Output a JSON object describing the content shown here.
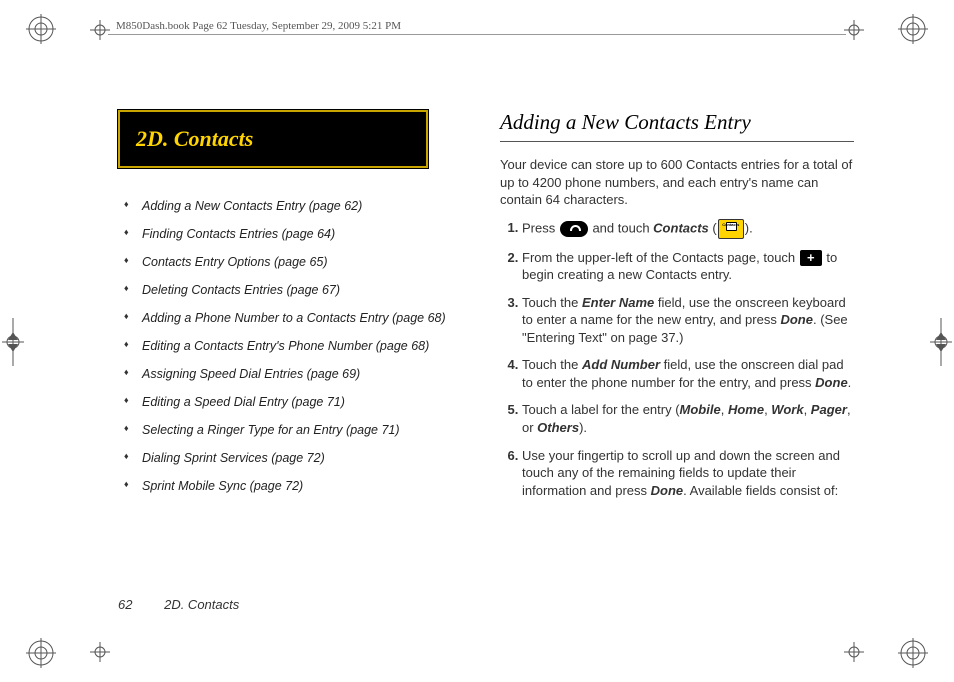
{
  "header": {
    "running": "M850Dash.book  Page 62  Tuesday, September 29, 2009  5:21 PM"
  },
  "section": {
    "title": "2D. Contacts"
  },
  "toc": [
    "Adding a New Contacts Entry (page 62)",
    "Finding Contacts Entries (page 64)",
    "Contacts Entry Options (page 65)",
    "Deleting Contacts Entries (page 67)",
    "Adding a Phone Number to a Contacts Entry (page 68)",
    "Editing a Contacts Entry's Phone Number (page 68)",
    "Assigning Speed Dial Entries (page 69)",
    "Editing a Speed Dial Entry (page 71)",
    "Selecting a Ringer Type for an Entry (page 71)",
    "Dialing Sprint Services (page 72)",
    "Sprint Mobile Sync (page 72)"
  ],
  "right": {
    "heading": "Adding a New Contacts Entry",
    "intro": "Your device can store up to 600 Contacts entries for a total of up to 4200 phone numbers, and each entry's name can contain 64 characters.",
    "steps": {
      "s1a": "Press ",
      "s1b": " and touch ",
      "s1c": "Contacts",
      "s1d": " (",
      "s1e": ").",
      "s2a": "From the upper-left of the Contacts page, touch ",
      "s2b": " to begin creating a new Contacts entry.",
      "s3a": "Touch the ",
      "s3b": "Enter Name",
      "s3c": " field, use the onscreen keyboard to enter a name for the new entry, and press ",
      "s3d": "Done",
      "s3e": ". (See \"Entering Text\" on page 37.)",
      "s4a": "Touch the ",
      "s4b": "Add Number",
      "s4c": " field, use the onscreen dial pad to enter the phone number for the entry, and press ",
      "s4d": "Done",
      "s4e": ".",
      "s5a": "Touch a label for the entry (",
      "s5b": "Mobile",
      "s5c": ", ",
      "s5d": "Home",
      "s5e": ", ",
      "s5f": "Work",
      "s5g": ", ",
      "s5h": "Pager",
      "s5i": ", or ",
      "s5j": "Others",
      "s5k": ").",
      "s6a": "Use your fingertip to scroll up and down the screen and touch any of the remaining fields to update their information and press ",
      "s6b": "Done",
      "s6c": ". Available fields consist of:"
    }
  },
  "footer": {
    "page": "62",
    "title": "2D. Contacts"
  }
}
